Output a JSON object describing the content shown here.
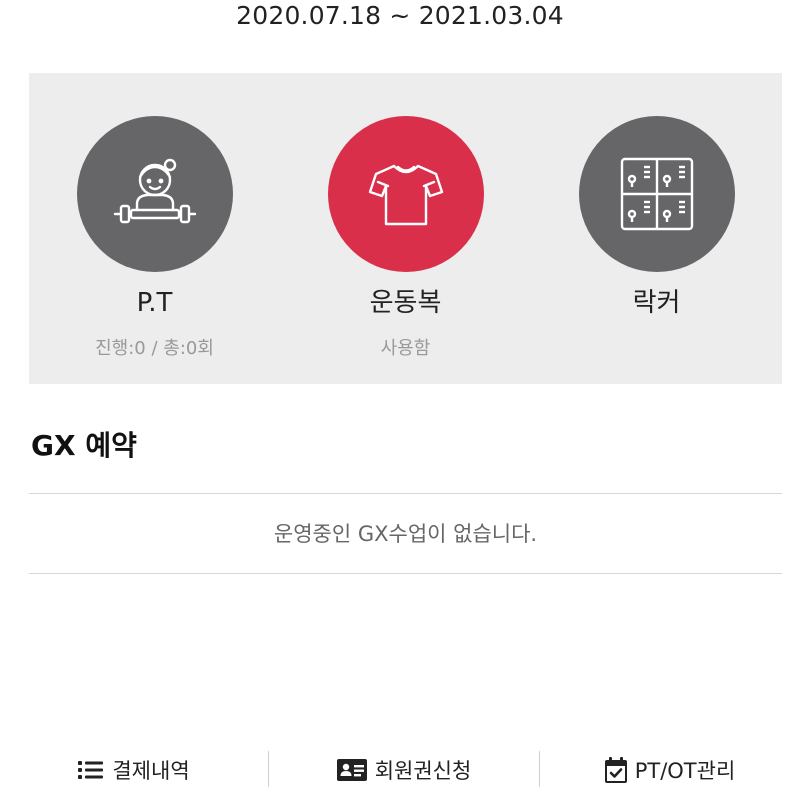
{
  "header": {
    "date_range": "2020.07.18 ~ 2021.03.04"
  },
  "services": [
    {
      "label": "P.T",
      "sub": "진행:0 / 총:0회",
      "icon": "pt-trainer-icon",
      "color": "#666668"
    },
    {
      "label": "운동복",
      "sub": "사용함",
      "icon": "tshirt-icon",
      "color": "#d92f4b"
    },
    {
      "label": "락커",
      "sub": "",
      "icon": "locker-icon",
      "color": "#666668"
    }
  ],
  "gx": {
    "title": "GX 예약",
    "empty_message": "운영중인 GX수업이 없습니다."
  },
  "bottom_nav": {
    "items": [
      {
        "label": "결제내역",
        "icon": "list-icon"
      },
      {
        "label": "회원권신청",
        "icon": "id-card-icon"
      },
      {
        "label": "PT/OT관리",
        "icon": "calendar-check-icon"
      }
    ]
  }
}
